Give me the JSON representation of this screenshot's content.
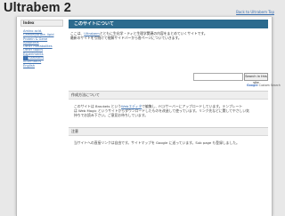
{
  "site": {
    "title": "Ultrabem 2",
    "top_link": "Back to Ultrabem Top"
  },
  "sidebar": {
    "title": "Index",
    "items": [
      {
        "label": "Amino acid,"
      },
      {
        "label": "Carbohydrate, lipid"
      },
      {
        "label": "Protein & Gene"
      },
      {
        "label": "Apoptosis"
      },
      {
        "label": "Other metabolites"
      },
      {
        "label": "Other topics"
      },
      {
        "label": "Experiments"
      },
      {
        "label": "██ Statistics"
      },
      {
        "label": "Informatics"
      },
      {
        "label": "English"
      }
    ]
  },
  "main": {
    "header": "このサイトについて",
    "intro_prefix": "ここは、",
    "intro_link": "Ultrabem",
    "intro_line1_rest": "とともに生化学・ティと生理学関連の内容をまとめていくサイトです。",
    "intro_line2": "最新のサイトを引続けて極解サイドバーから各ページについていきます。"
  },
  "search": {
    "button": "Search in this site",
    "powered_prefix": "Google",
    "powered_suffix": "Custom Search"
  },
  "sections": {
    "production": {
      "title": "作成方法について",
      "line1_prefix": "このサイトは Brackets という",
      "line1_link": "Webエディタ",
      "line1_rest": "で編集し、FC2サーバーにアップロードしています。テンプレート",
      "line2": "は Web Magic というサイトからダウンロードしたものを改造して使っています。リンク先などに関してやさしい気",
      "line3": "持ちでお読み下さい。ご意見お待ちしています。"
    },
    "notes": {
      "title": "注意",
      "body": "当サイトへの直接リンクは自由です。サイトマップを Google に送っています。Sub page も登録しました。"
    }
  }
}
